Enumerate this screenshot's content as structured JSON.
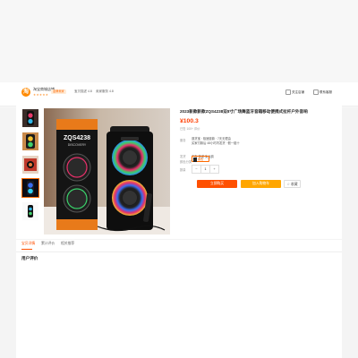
{
  "store": {
    "logo_text": "淘",
    "name": "淘宝商城店铺",
    "stars": "★★★★★",
    "badge": "金牌卖家",
    "meta1": "宝贝描述 4.8",
    "meta2": "卖家服务 4.8",
    "follow_label": "关注店铺",
    "contact_label": "联系客服"
  },
  "product": {
    "title": "2023新款新款ZQS4238双8寸广场舞蓝牙音箱移动便携式拉杆户外音响",
    "price": "¥100.3",
    "sold": "已售 100+ 评价",
    "service_label": "服务",
    "service_lines": [
      "退货宝  ·  极速退款  ·  7天无理由",
      "买家付款后 48小时内发货  ·  假一赔十"
    ],
    "ship_label": "发货",
    "ship_value": "广东  快递 免运费",
    "color_label": "颜色分类",
    "color_value": "黑色",
    "qty_label": "数量",
    "qty_minus": "−",
    "qty_value": "1",
    "qty_plus": "+",
    "buy_label": "立即购买",
    "cart_label": "加入购物车",
    "fav_label": "☆ 收藏"
  },
  "gallery": {
    "speaker_model": "ZQS4238",
    "speaker_subtitle": "DISCOVERY"
  },
  "tabs": [
    {
      "label": "宝贝详情",
      "active": true
    },
    {
      "label": "累计评价",
      "active": false
    },
    {
      "label": "相关推荐",
      "active": false
    }
  ],
  "section_title": "用户评价",
  "colors": {
    "accent": "#ff5000",
    "cart": "#ffa600",
    "price": "#ff3d00"
  }
}
